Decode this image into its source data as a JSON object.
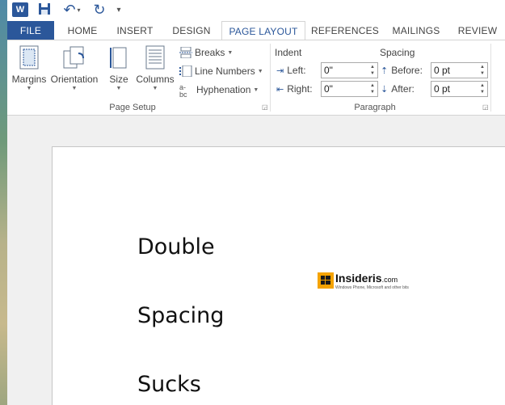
{
  "qat": {
    "app_icon": "word-icon",
    "app_letter": "W",
    "save_icon": "save-icon",
    "undo_icon": "undo-icon",
    "redo_icon": "redo-icon",
    "more_icon": "customize-qat-icon"
  },
  "tabs": [
    {
      "label": "FILE"
    },
    {
      "label": "HOME"
    },
    {
      "label": "INSERT"
    },
    {
      "label": "DESIGN"
    },
    {
      "label": "PAGE LAYOUT"
    },
    {
      "label": "REFERENCES"
    },
    {
      "label": "MAILINGS"
    },
    {
      "label": "REVIEW"
    }
  ],
  "active_tab": "PAGE LAYOUT",
  "page_setup": {
    "group_label": "Page Setup",
    "margins": "Margins",
    "orientation": "Orientation",
    "size": "Size",
    "columns": "Columns",
    "breaks": "Breaks",
    "line_numbers": "Line Numbers",
    "hyphenation": "Hyphenation"
  },
  "paragraph": {
    "group_label": "Paragraph",
    "indent_title": "Indent",
    "spacing_title": "Spacing",
    "left_label": "Left:",
    "left_value": "0\"",
    "right_label": "Right:",
    "right_value": "0\"",
    "before_label": "Before:",
    "before_value": "0 pt",
    "after_label": "After:",
    "after_value": "0 pt"
  },
  "document": {
    "lines": [
      "Double",
      "Spacing",
      "Sucks"
    ],
    "watermark_name": "Insideris",
    "watermark_domain": ".com",
    "watermark_tagline": "Windows Phone, Microsoft and other bits"
  },
  "colors": {
    "accent": "#2b579a",
    "ribbon_border": "#d4d4d4",
    "watermark_orange": "#f5a300"
  }
}
